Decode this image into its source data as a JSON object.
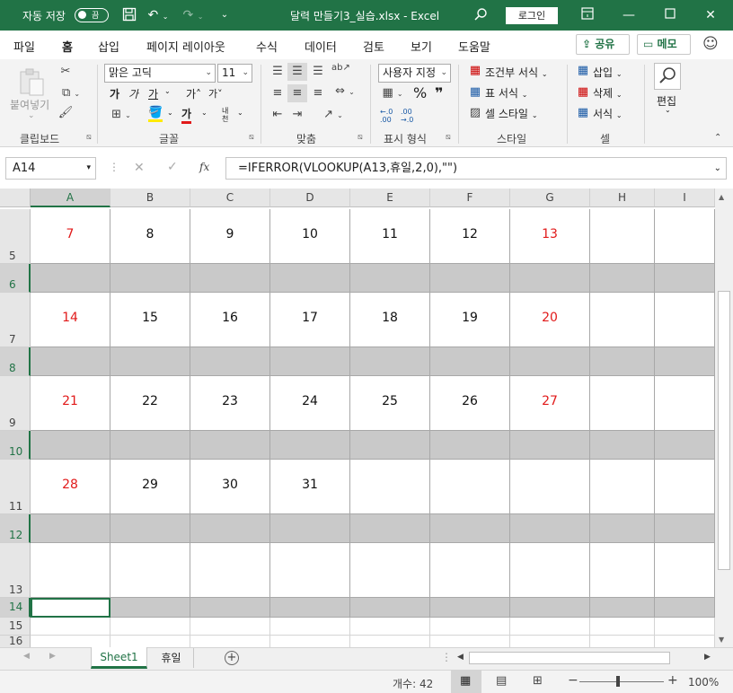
{
  "titlebar": {
    "autosave_label": "자동 저장",
    "autosave_state": "끔",
    "doc_title": "달력 만들기3_실습.xlsx  -  Excel",
    "login_label": "로그인",
    "save_icon": "save-icon",
    "undo_icon": "undo-icon",
    "redo_icon": "redo-icon",
    "search_icon": "search-icon"
  },
  "tabs": [
    "파일",
    "홈",
    "삽입",
    "페이지 레이아웃",
    "수식",
    "데이터",
    "검토",
    "보기",
    "도움말"
  ],
  "share_label": "공유",
  "memo_label": "메모",
  "ribbon": {
    "clipboard": {
      "paste_label": "붙여넣기",
      "group_label": "클립보드"
    },
    "font": {
      "font_name": "맑은 고딕",
      "font_size": "11",
      "group_label": "글꼴",
      "bold": "가",
      "italic": "가",
      "underline": "가",
      "grow": "가˄",
      "shrink": "가˅",
      "color_a": "가",
      "phonetic": "내천"
    },
    "alignment": {
      "group_label": "맞춤"
    },
    "number": {
      "format": "사용자 지정",
      "group_label": "표시 형식",
      "percent": "%",
      "comma": "❞",
      "inc_dec": "←.0 .00",
      "dec_dec": ".00 →.0"
    },
    "styles": {
      "conditional": "조건부 서식",
      "table": "표 서식",
      "cell": "셀 스타일",
      "group_label": "스타일"
    },
    "cells": {
      "insert": "삽입",
      "delete": "삭제",
      "format": "서식",
      "group_label": "셀"
    },
    "editing": {
      "label": "편집"
    }
  },
  "namebox": "A14",
  "formula": "=IFERROR(VLOOKUP(A13,휴일,2,0),\"\")",
  "fx_label": "fx",
  "columns": [
    "A",
    "B",
    "C",
    "D",
    "E",
    "F",
    "G",
    "H",
    "I"
  ],
  "rows": [
    {
      "num": "5",
      "kind": "date",
      "cells": [
        "7",
        "8",
        "9",
        "10",
        "11",
        "12",
        "13",
        "",
        ""
      ]
    },
    {
      "num": "6",
      "kind": "band",
      "cells": []
    },
    {
      "num": "7",
      "kind": "date",
      "cells": [
        "14",
        "15",
        "16",
        "17",
        "18",
        "19",
        "20",
        "",
        ""
      ]
    },
    {
      "num": "8",
      "kind": "band",
      "cells": []
    },
    {
      "num": "9",
      "kind": "date",
      "cells": [
        "21",
        "22",
        "23",
        "24",
        "25",
        "26",
        "27",
        "",
        ""
      ]
    },
    {
      "num": "10",
      "kind": "band",
      "cells": []
    },
    {
      "num": "11",
      "kind": "date",
      "cells": [
        "28",
        "29",
        "30",
        "31",
        "",
        "",
        "",
        "",
        ""
      ]
    },
    {
      "num": "12",
      "kind": "band",
      "cells": []
    },
    {
      "num": "13",
      "kind": "date",
      "cells": [
        "",
        "",
        "",
        "",
        "",
        "",
        "",
        "",
        ""
      ]
    },
    {
      "num": "14",
      "kind": "band",
      "cells": []
    },
    {
      "num": "15",
      "kind": "small",
      "cells": []
    },
    {
      "num": "16",
      "kind": "small",
      "cells": []
    }
  ],
  "colors": {
    "weekend": "#e11a1a",
    "accent": "#217346",
    "band": "#c9c9c9"
  },
  "sheets": [
    "Sheet1",
    "휴일"
  ],
  "active_sheet": "Sheet1",
  "status": {
    "count_label": "개수: 42",
    "zoom": "100%",
    "zoom_minus": "−",
    "zoom_plus": "+"
  }
}
